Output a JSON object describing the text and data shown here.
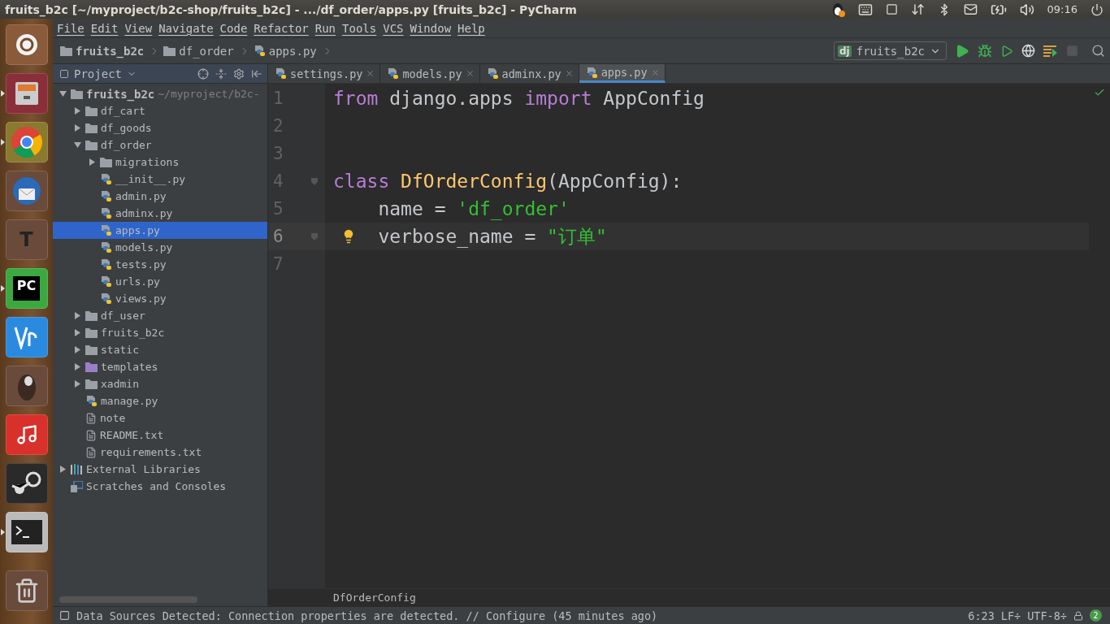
{
  "top_panel": {
    "title": "fruits_b2c [~/myproject/b2c-shop/fruits_b2c] - .../df_order/apps.py [fruits_b2c] - PyCharm",
    "clock": "09:16"
  },
  "launcher": [
    {
      "kind": "ubuntu",
      "active": false
    },
    {
      "kind": "files",
      "active": true
    },
    {
      "kind": "chrome",
      "active": true
    },
    {
      "kind": "thunderbird",
      "active": false
    },
    {
      "kind": "text",
      "glyph": "T",
      "active": false
    },
    {
      "kind": "pycharm",
      "glyph": "PC",
      "active": true
    },
    {
      "kind": "vnc",
      "active": false
    },
    {
      "kind": "beaver",
      "active": false
    },
    {
      "kind": "music",
      "active": false
    },
    {
      "kind": "steam",
      "active": false
    },
    {
      "kind": "terminal",
      "active": true
    },
    {
      "kind": "trash",
      "active": false
    }
  ],
  "menu": [
    "File",
    "Edit",
    "View",
    "Navigate",
    "Code",
    "Refactor",
    "Run",
    "Tools",
    "VCS",
    "Window",
    "Help"
  ],
  "breadcrumbs": [
    {
      "label": "fruits_b2c",
      "kind": "folder"
    },
    {
      "label": "df_order",
      "kind": "folder"
    },
    {
      "label": "apps.py",
      "kind": "python"
    }
  ],
  "run_config": {
    "badge": "dj",
    "label": "fruits_b2c"
  },
  "project_panel": {
    "title": "Project"
  },
  "tree": [
    {
      "label": "fruits_b2c",
      "kind": "root",
      "path": "~/myproject/b2c-",
      "expanded": true,
      "selected": false,
      "children": [
        {
          "label": "df_cart",
          "kind": "folder",
          "expanded": false,
          "selected": false
        },
        {
          "label": "df_goods",
          "kind": "folder",
          "expanded": false,
          "selected": false
        },
        {
          "label": "df_order",
          "kind": "folder",
          "expanded": true,
          "selected": false,
          "children": [
            {
              "label": "migrations",
              "kind": "folder",
              "expanded": false,
              "selected": false
            },
            {
              "label": "__init__.py",
              "kind": "python",
              "selected": false
            },
            {
              "label": "admin.py",
              "kind": "python",
              "selected": false
            },
            {
              "label": "adminx.py",
              "kind": "python",
              "selected": false
            },
            {
              "label": "apps.py",
              "kind": "python",
              "selected": true
            },
            {
              "label": "models.py",
              "kind": "python",
              "selected": false
            },
            {
              "label": "tests.py",
              "kind": "python",
              "selected": false
            },
            {
              "label": "urls.py",
              "kind": "python",
              "selected": false
            },
            {
              "label": "views.py",
              "kind": "python",
              "selected": false
            }
          ]
        },
        {
          "label": "df_user",
          "kind": "folder",
          "expanded": false,
          "selected": false
        },
        {
          "label": "fruits_b2c",
          "kind": "folder",
          "expanded": false,
          "selected": false
        },
        {
          "label": "static",
          "kind": "folder",
          "expanded": false,
          "selected": false
        },
        {
          "label": "templates",
          "kind": "template_folder",
          "expanded": false,
          "selected": false
        },
        {
          "label": "xadmin",
          "kind": "folder",
          "expanded": false,
          "selected": false
        },
        {
          "label": "manage.py",
          "kind": "python",
          "selected": false
        },
        {
          "label": "note",
          "kind": "text",
          "selected": false
        },
        {
          "label": "README.txt",
          "kind": "text",
          "selected": false
        },
        {
          "label": "requirements.txt",
          "kind": "text",
          "selected": false
        }
      ]
    },
    {
      "label": "External Libraries",
      "kind": "library",
      "expanded": false,
      "selected": false
    },
    {
      "label": "Scratches and Consoles",
      "kind": "scratches",
      "selected": false
    }
  ],
  "tabs": [
    {
      "label": "settings.py",
      "selected": false
    },
    {
      "label": "models.py",
      "selected": false
    },
    {
      "label": "adminx.py",
      "selected": false
    },
    {
      "label": "apps.py",
      "selected": true
    }
  ],
  "code": [
    {
      "number": "1",
      "current": false,
      "tokens": [
        {
          "kind": "keyword",
          "text": "from"
        },
        {
          "kind": "plain",
          "text": " django.apps "
        },
        {
          "kind": "keyword",
          "text": "import"
        },
        {
          "kind": "plain",
          "text": " AppConfig"
        }
      ]
    },
    {
      "number": "2",
      "current": false
    },
    {
      "number": "3",
      "current": false
    },
    {
      "number": "4",
      "current": false,
      "fold": true,
      "tokens": [
        {
          "kind": "keyword",
          "text": "class"
        },
        {
          "kind": "classname",
          "text": " DfOrderConfig"
        },
        {
          "kind": "plain",
          "text": "(AppConfig):"
        }
      ]
    },
    {
      "number": "5",
      "current": false,
      "tokens": [
        {
          "kind": "plain",
          "text": "    name = "
        },
        {
          "kind": "string",
          "text": "'df_order'"
        }
      ]
    },
    {
      "number": "6",
      "current": true,
      "fold": true,
      "bulb": true,
      "tokens": [
        {
          "kind": "plain",
          "text": "    verbose_name = "
        },
        {
          "kind": "string",
          "text": "\"订单\""
        }
      ]
    },
    {
      "number": "7",
      "current": false
    }
  ],
  "editor_breadcrumb": "DfOrderConfig",
  "status_bar": {
    "message": "Data Sources Detected: Connection properties are detected. // Configure (45 minutes ago)",
    "position": "6:23",
    "line_separator": "LF÷",
    "encoding": "UTF-8÷",
    "notifications": "2"
  }
}
